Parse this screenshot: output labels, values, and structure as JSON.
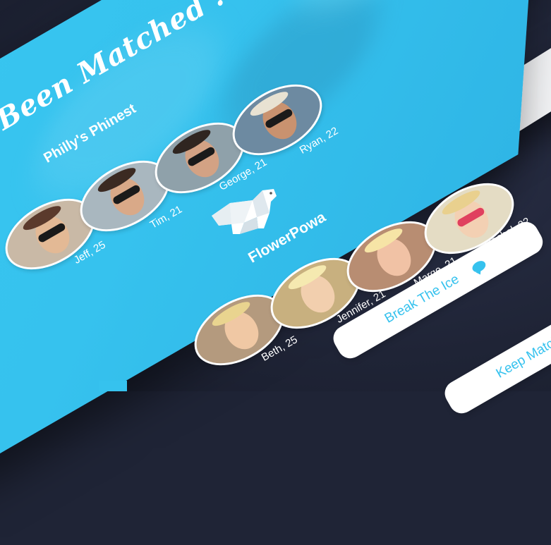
{
  "header": {
    "title": "Been Matched !",
    "group_name": "Philly's Phinest"
  },
  "profile": {
    "name": "FlowerPowa",
    "icon": "polar-bear-icon"
  },
  "group_members": [
    {
      "label": "Jeff, 25"
    },
    {
      "label": "Tim, 21"
    },
    {
      "label": "George, 21"
    },
    {
      "label": "Ryan, 22"
    }
  ],
  "matches": [
    {
      "label": "Beth, 25"
    },
    {
      "label": "Jennifer, 21"
    },
    {
      "label": "Marge, 21"
    },
    {
      "label": "Rachel, 22"
    }
  ],
  "actions": {
    "break_ice_label": "Break The Ice",
    "break_ice_icon": "chat-bubble-icon",
    "keep_label": "Keep Matching"
  },
  "colors": {
    "accent": "#36c2ee",
    "background": "#1f2436",
    "button": "#ffffff"
  }
}
